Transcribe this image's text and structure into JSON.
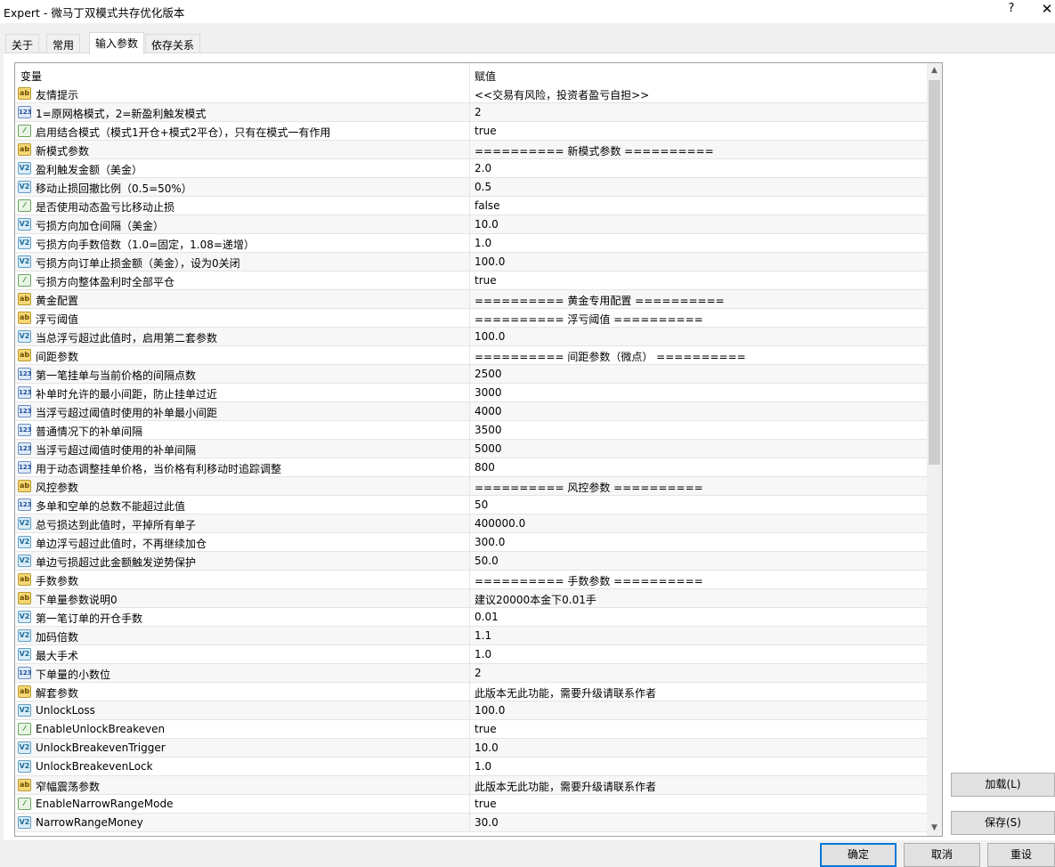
{
  "window": {
    "title": "Expert - 微马丁双模式共存优化版本",
    "help": "?",
    "close": "✕"
  },
  "tabs": [
    "关于",
    "常用",
    "输入参数",
    "依存关系"
  ],
  "table": {
    "headers": {
      "variable": "变量",
      "value": "赋值"
    },
    "rows": [
      {
        "icon": "ab",
        "name": "友情提示",
        "value": "<<交易有风险，投资者盈亏自担>>"
      },
      {
        "icon": "123",
        "name": "1=原网格模式，2=新盈利触发模式",
        "value": "2"
      },
      {
        "icon": "bool",
        "name": "启用结合模式（模式1开仓+模式2平仓），只有在模式一有作用",
        "value": "true"
      },
      {
        "icon": "ab",
        "name": "新模式参数",
        "value": "========== 新模式参数 =========="
      },
      {
        "icon": "v2",
        "name": "盈利触发金额（美金）",
        "value": "2.0"
      },
      {
        "icon": "v2",
        "name": "移动止损回撤比例（0.5=50%）",
        "value": "0.5"
      },
      {
        "icon": "bool",
        "name": "是否使用动态盈亏比移动止损",
        "value": "false"
      },
      {
        "icon": "v2",
        "name": "亏损方向加仓间隔（美金）",
        "value": "10.0"
      },
      {
        "icon": "v2",
        "name": "亏损方向手数倍数（1.0=固定，1.08=递增）",
        "value": "1.0"
      },
      {
        "icon": "v2",
        "name": "亏损方向订单止损金额（美金），设为0关闭",
        "value": "100.0"
      },
      {
        "icon": "bool",
        "name": "亏损方向整体盈利时全部平仓",
        "value": "true"
      },
      {
        "icon": "ab",
        "name": "黄金配置",
        "value": "========== 黄金专用配置 =========="
      },
      {
        "icon": "ab",
        "name": "浮亏阈值",
        "value": "========== 浮亏阈值 =========="
      },
      {
        "icon": "v2",
        "name": "当总浮亏超过此值时，启用第二套参数",
        "value": "100.0"
      },
      {
        "icon": "ab",
        "name": "间距参数",
        "value": "========== 间距参数（微点） =========="
      },
      {
        "icon": "123",
        "name": "第一笔挂单与当前价格的间隔点数",
        "value": "2500"
      },
      {
        "icon": "123",
        "name": "补单时允许的最小间距，防止挂单过近",
        "value": "3000"
      },
      {
        "icon": "123",
        "name": "当浮亏超过阈值时使用的补单最小间距",
        "value": "4000"
      },
      {
        "icon": "123",
        "name": "普通情况下的补单间隔",
        "value": "3500"
      },
      {
        "icon": "123",
        "name": "当浮亏超过阈值时使用的补单间隔",
        "value": "5000"
      },
      {
        "icon": "123",
        "name": "用于动态调整挂单价格，当价格有利移动时追踪调整",
        "value": "800"
      },
      {
        "icon": "ab",
        "name": "风控参数",
        "value": "========== 风控参数 =========="
      },
      {
        "icon": "123",
        "name": "多单和空单的总数不能超过此值",
        "value": "50"
      },
      {
        "icon": "v2",
        "name": "总亏损达到此值时，平掉所有单子",
        "value": "400000.0"
      },
      {
        "icon": "v2",
        "name": "单边浮亏超过此值时，不再继续加仓",
        "value": "300.0"
      },
      {
        "icon": "v2",
        "name": "单边亏损超过此金额触发逆势保护",
        "value": "50.0"
      },
      {
        "icon": "ab",
        "name": "手数参数",
        "value": "========== 手数参数 =========="
      },
      {
        "icon": "ab",
        "name": "下单量参数说明0",
        "value": "建议20000本金下0.01手"
      },
      {
        "icon": "v2",
        "name": "第一笔订单的开仓手数",
        "value": "0.01"
      },
      {
        "icon": "v2",
        "name": "加码倍数",
        "value": "1.1"
      },
      {
        "icon": "v2",
        "name": "最大手术",
        "value": "1.0"
      },
      {
        "icon": "123",
        "name": "下单量的小数位",
        "value": "2"
      },
      {
        "icon": "ab",
        "name": "解套参数",
        "value": "此版本无此功能，需要升级请联系作者"
      },
      {
        "icon": "v2",
        "name": "UnlockLoss",
        "value": "100.0"
      },
      {
        "icon": "bool",
        "name": "EnableUnlockBreakeven",
        "value": "true"
      },
      {
        "icon": "v2",
        "name": "UnlockBreakevenTrigger",
        "value": "10.0"
      },
      {
        "icon": "v2",
        "name": "UnlockBreakevenLock",
        "value": "1.0"
      },
      {
        "icon": "ab",
        "name": "窄幅震荡参数",
        "value": "此版本无此功能，需要升级请联系作者"
      },
      {
        "icon": "bool",
        "name": "EnableNarrowRangeMode",
        "value": "true"
      },
      {
        "icon": "v2",
        "name": "NarrowRangeMoney",
        "value": "30.0"
      }
    ]
  },
  "side_buttons": {
    "load": "加载(L)",
    "save": "保存(S)"
  },
  "bottom_buttons": {
    "ok": "确定",
    "cancel": "取消",
    "reset": "重设"
  },
  "icon_labels": {
    "ab": "ab",
    "123": "123",
    "v2": "V2",
    "bool": "⁄"
  }
}
